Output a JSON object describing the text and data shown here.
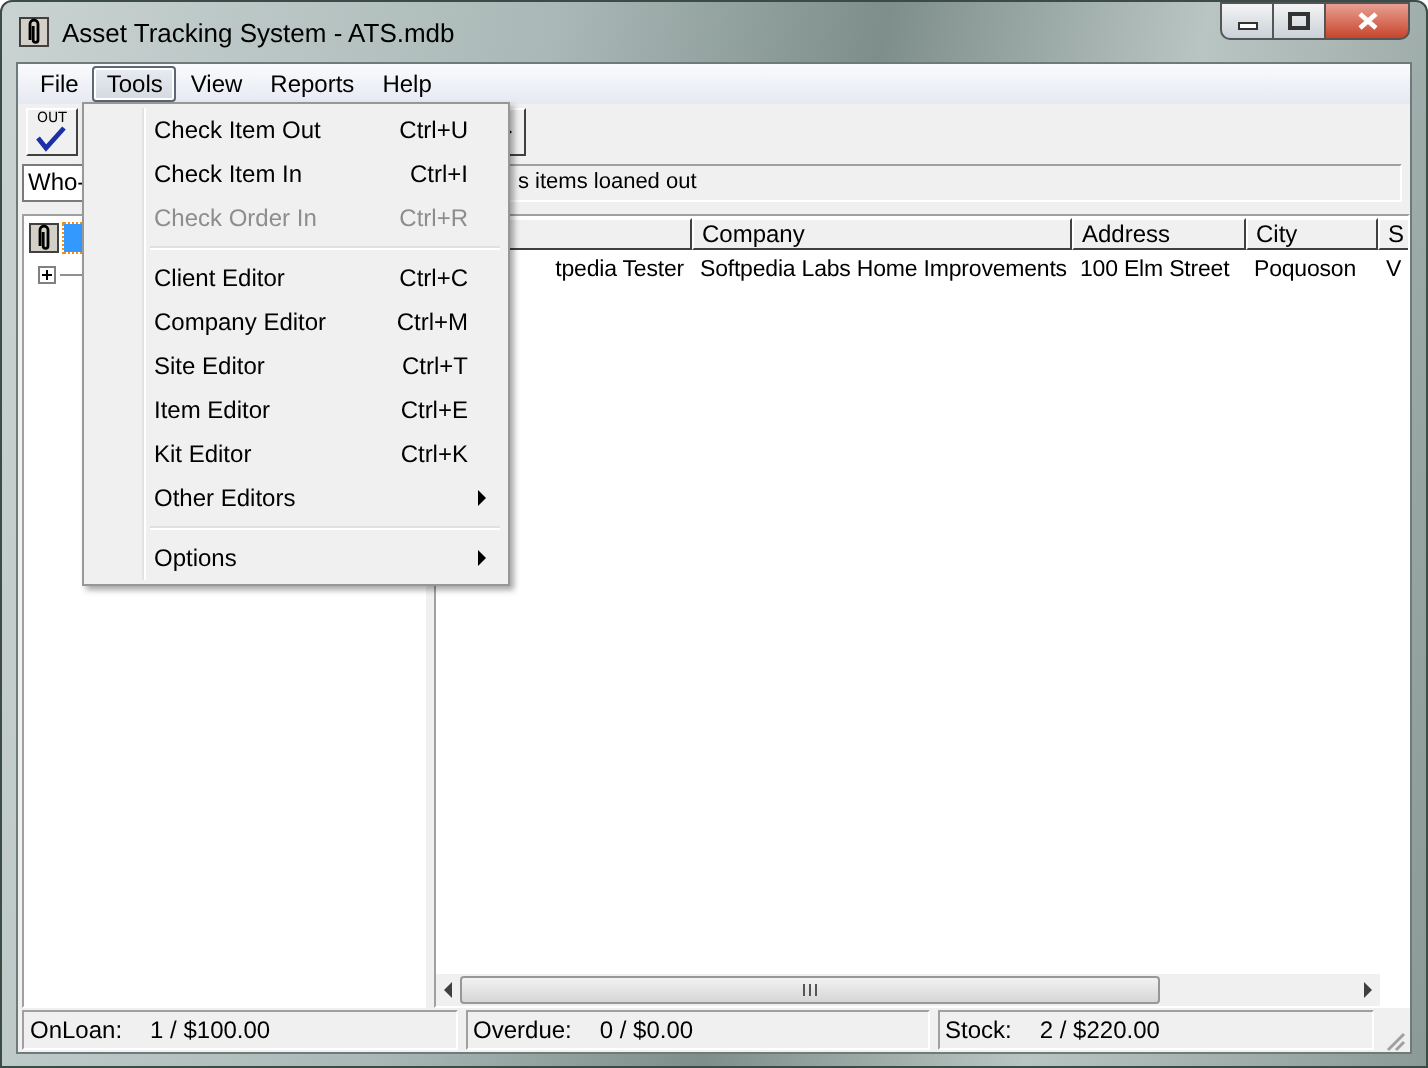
{
  "window": {
    "title": "Asset Tracking System - ATS.mdb"
  },
  "menu_bar": [
    {
      "label": "File",
      "selected": false
    },
    {
      "label": "Tools",
      "selected": true
    },
    {
      "label": "View",
      "selected": false
    },
    {
      "label": "Reports",
      "selected": false
    },
    {
      "label": "Help",
      "selected": false
    }
  ],
  "toolbar": {
    "out_button": {
      "label": "OUT"
    }
  },
  "filter": {
    "value": "Who-",
    "description": "s items loaned out"
  },
  "tree": {
    "root": {
      "selected": true,
      "children_expanded": false
    }
  },
  "list": {
    "columns": [
      "",
      "Company",
      "Address",
      "City",
      "S"
    ],
    "rows": [
      {
        "cells": [
          "tpedia Tester",
          "Softpedia Labs Home Improvements",
          "100 Elm Street",
          "Poquoson",
          "V"
        ]
      }
    ]
  },
  "tools_menu": [
    {
      "kind": "item",
      "label": "Check Item Out",
      "shortcut": "Ctrl+U",
      "disabled": false
    },
    {
      "kind": "item",
      "label": "Check Item In",
      "shortcut": "Ctrl+I",
      "disabled": false
    },
    {
      "kind": "item",
      "label": "Check Order In",
      "shortcut": "Ctrl+R",
      "disabled": true
    },
    {
      "kind": "separator"
    },
    {
      "kind": "item",
      "label": "Client Editor",
      "shortcut": "Ctrl+C",
      "disabled": false
    },
    {
      "kind": "item",
      "label": "Company Editor",
      "shortcut": "Ctrl+M",
      "disabled": false
    },
    {
      "kind": "item",
      "label": "Site Editor",
      "shortcut": "Ctrl+T",
      "disabled": false
    },
    {
      "kind": "item",
      "label": "Item Editor",
      "shortcut": "Ctrl+E",
      "disabled": false
    },
    {
      "kind": "item",
      "label": "Kit Editor",
      "shortcut": "Ctrl+K",
      "disabled": false
    },
    {
      "kind": "submenu",
      "label": "Other Editors",
      "disabled": false
    },
    {
      "kind": "separator"
    },
    {
      "kind": "submenu",
      "label": "Options",
      "disabled": false
    }
  ],
  "status_bar": [
    {
      "label": "OnLoan:",
      "value": "1 / $100.00"
    },
    {
      "label": "Overdue:",
      "value": "0 / $0.00"
    },
    {
      "label": "Stock:",
      "value": "2 / $220.00"
    }
  ]
}
